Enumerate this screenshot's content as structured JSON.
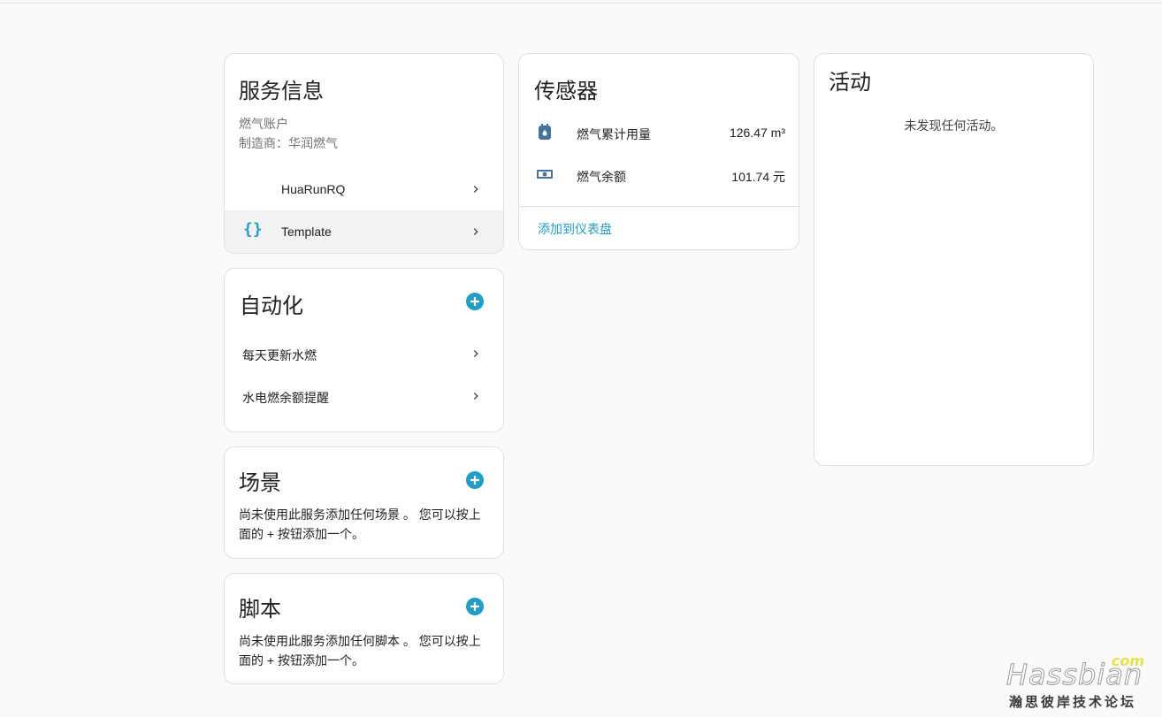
{
  "service_info": {
    "title": "服务信息",
    "account_label": "燃气账户",
    "manufacturer": "制造商：华润燃气",
    "items": [
      {
        "label": "HuaRunRQ",
        "icon": "none"
      },
      {
        "label": "Template",
        "icon": "braces-icon"
      }
    ]
  },
  "automation": {
    "title": "自动化",
    "items": [
      {
        "label": "每天更新水燃"
      },
      {
        "label": "水电燃余额提醒"
      }
    ]
  },
  "scenes": {
    "title": "场景",
    "empty_text_line1": "尚未使用此服务添加任何场景 。 您可以按上",
    "empty_text_line2": "面的 + 按钮添加一个。"
  },
  "scripts": {
    "title": "脚本",
    "empty_text_line1": "尚未使用此服务添加任何脚本 。 您可以按上",
    "empty_text_line2": "面的 + 按钮添加一个。"
  },
  "sensors": {
    "title": "传感器",
    "items": [
      {
        "label": "燃气累计用量",
        "value": "126.47 m³",
        "icon": "gas-meter-icon"
      },
      {
        "label": "燃气余额",
        "value": "101.74 元",
        "icon": "cash-icon"
      }
    ],
    "add_to_dashboard": "添加到仪表盘"
  },
  "activity": {
    "title": "活动",
    "empty_text": "未发现任何活动。"
  },
  "watermark": {
    "domain": "com",
    "brand": "Hassbian",
    "subtitle": "瀚思彼岸技术论坛"
  },
  "colors": {
    "accent": "#1e9fc7",
    "icon_dark": "#44739e",
    "selected_row": "#f2f2f2"
  }
}
